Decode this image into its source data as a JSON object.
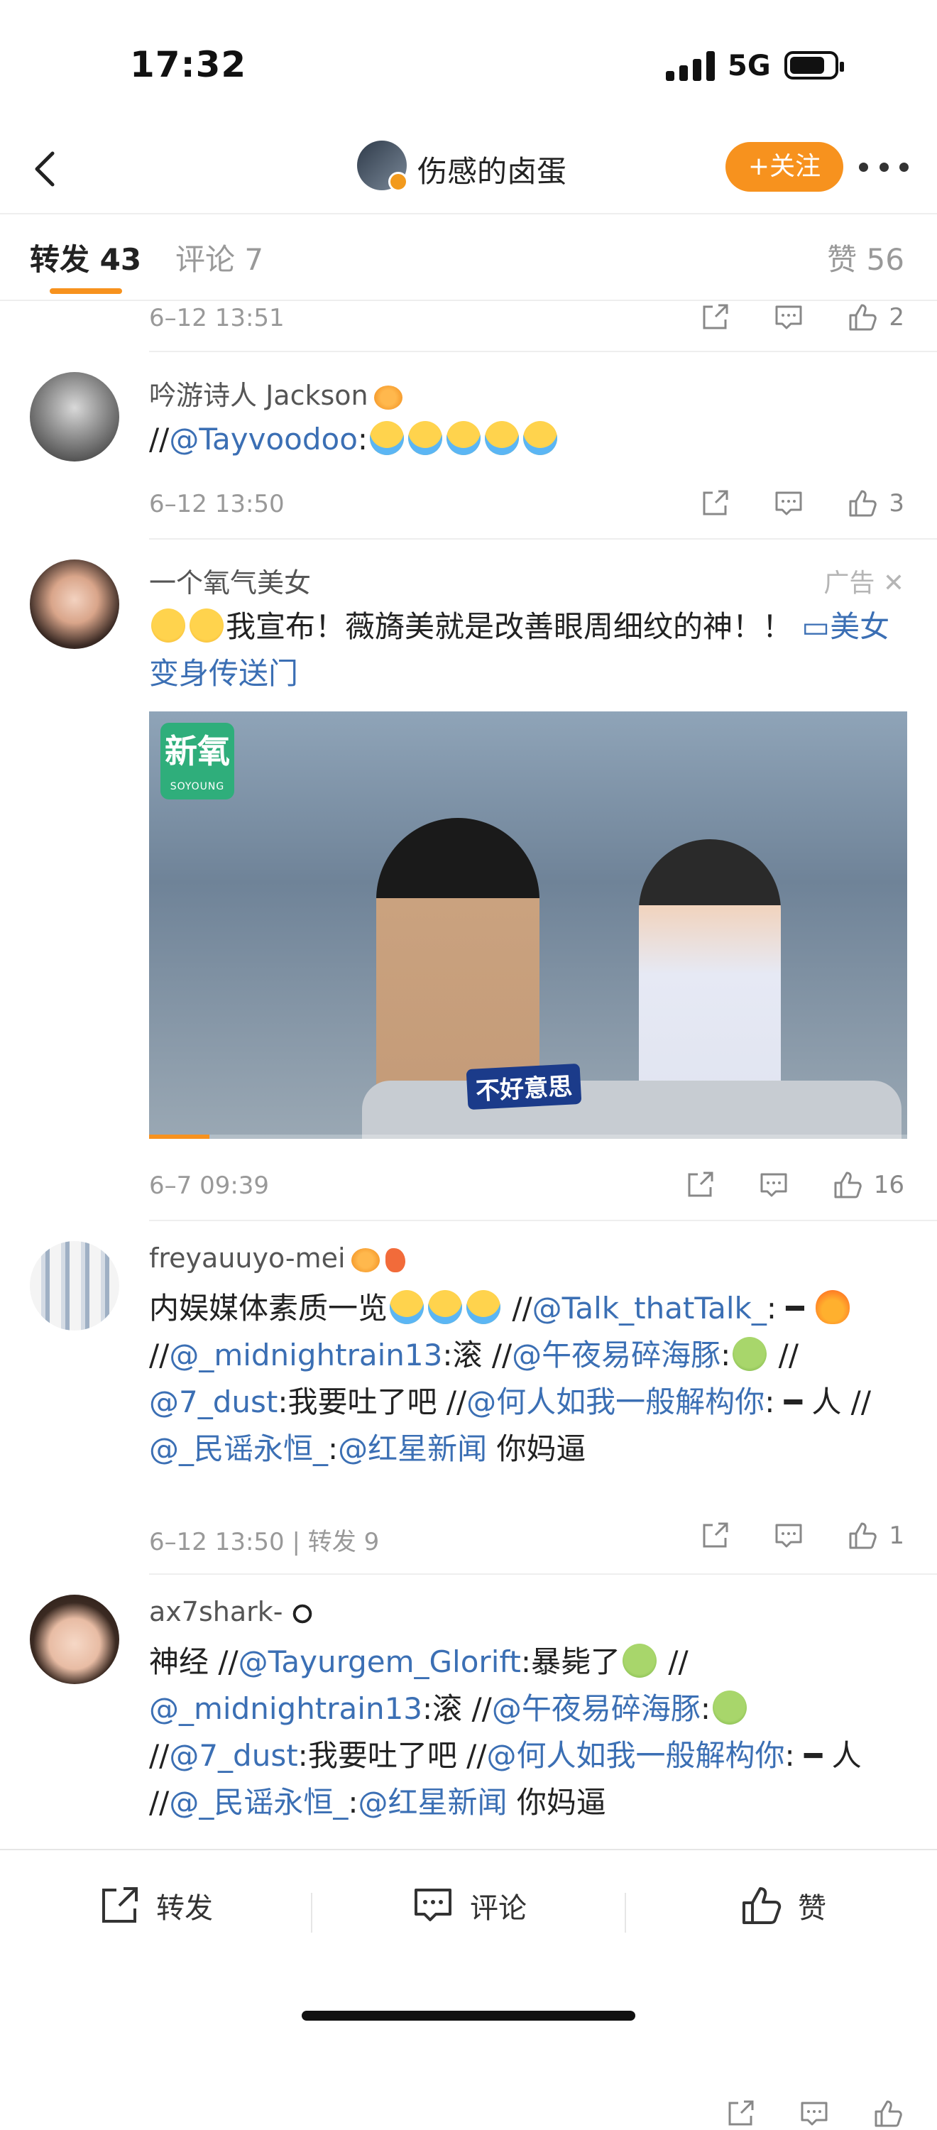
{
  "status": {
    "time": "17:32",
    "network": "5G",
    "battery_level": 0.8
  },
  "nav": {
    "title": "伤感的卤蛋",
    "follow_label": "+关注"
  },
  "tabs": {
    "repost_label": "转发",
    "repost_count": "43",
    "comment_label": "评论",
    "comment_count": "7",
    "like_label": "赞",
    "like_count": "56"
  },
  "feed": {
    "top_partial": {
      "time": "6–12 13:51",
      "likes": "2"
    },
    "post1": {
      "user": "吟游诗人 Jackson",
      "prefix": "//",
      "mention": "@Tayvoodoo",
      "colon": ":",
      "time": "6–12 13:50",
      "likes": "3"
    },
    "ad": {
      "user": "一个氧气美女",
      "ad_label": "广告",
      "text": "我宣布！薇旖美就是改善眼周细纹的神！！",
      "link1": "美",
      "link2": "女变身传送门",
      "logo_text": "新氧",
      "logo_sub": "SOYOUNG",
      "caption": "不好意思",
      "video_progress": 0.08,
      "time": "6–7 09:39",
      "likes": "16"
    },
    "post2": {
      "user": "freyauuyo-mei",
      "t1": "内娱媒体素质一览",
      "t2": " //",
      "m1": "@Talk_thatTalk_",
      "t3": ": ━",
      "t4": " //",
      "m2": "@_midnightrain13",
      "t5": ":滚 //",
      "m3": "@午夜易碎海豚",
      "t6": ":",
      "t7": " //",
      "m4": "@7_dust",
      "t8": ":我要吐了吧 //",
      "m5": "@何人如我一般解构你",
      "t9": ": ━ 人 //",
      "m6": "@_民谣永恒_",
      "t10": ":",
      "m7": "@红星新闻",
      "t11": " 你妈逼",
      "time": "6–12 13:50",
      "repost_meta": "转发 9",
      "likes": "1"
    },
    "post3": {
      "user": "ax7shark-",
      "t1": "神经 //",
      "m1": "@Tayurgem_Glorift",
      "t2": ":暴毙了",
      "t3": " //",
      "m2": "@_midnightrain13",
      "t4": ":滚 //",
      "m3": "@午夜易碎海豚",
      "t5": ":",
      "t6": " //",
      "m4": "@7_dust",
      "t7": ":我要吐了吧 //",
      "m5": "@何人如我一般解构你",
      "t8": ": ━ 人 //",
      "m6": "@_民谣永恒_",
      "t9": ":",
      "m7": "@红星新闻",
      "t10": " 你妈逼"
    }
  },
  "bottom_bar": {
    "repost": "转发",
    "comment": "评论",
    "like": "赞"
  },
  "colors": {
    "accent": "#f7921e",
    "link": "#3b6fb4"
  },
  "icons": [
    "back-icon",
    "more-icon",
    "share-icon",
    "comment-icon",
    "like-icon",
    "close-icon",
    "video-icon"
  ]
}
